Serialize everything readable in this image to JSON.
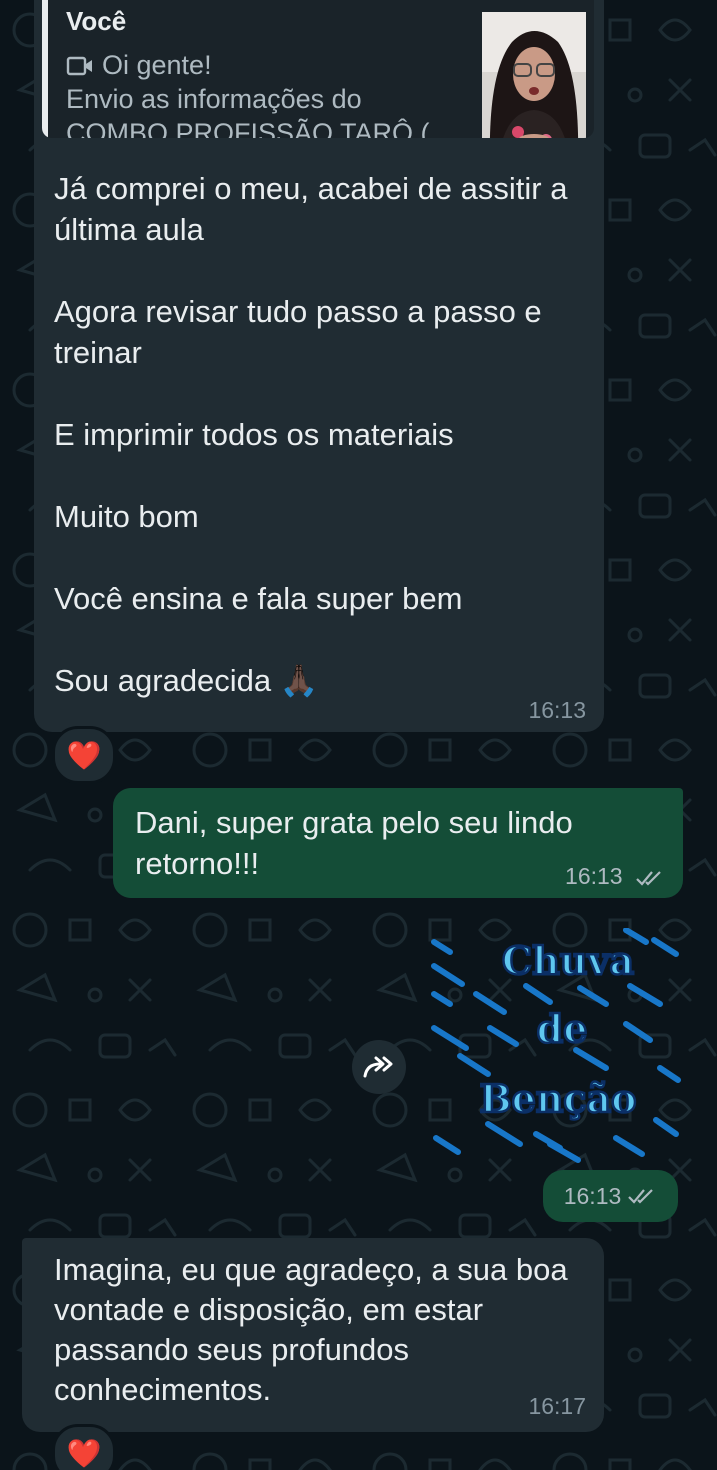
{
  "colors": {
    "background": "#0b141a",
    "incoming_bubble": "#202c33",
    "outgoing_bubble": "#144d37",
    "timestamp": "#8696a0",
    "read_ticks": "#aebac1"
  },
  "messages": [
    {
      "direction": "incoming",
      "quote": {
        "author": "Você",
        "line1_icon": "video-icon",
        "line1": "Oi gente!",
        "line2": "Envio as informações do",
        "line3": "COMBO PROFISSÃO TARÔ (..."
      },
      "paragraphs": [
        "Já comprei o meu, acabei de assitir a última aula",
        "Agora revisar tudo passo a passo e treinar",
        "E imprimir todos os materiais",
        "Muito bom",
        "Você ensina e fala super bem",
        "Sou agradecida 🙏🏿"
      ],
      "time": "16:13",
      "reaction": "❤️"
    },
    {
      "direction": "outgoing",
      "text": "Dani, super grata pelo seu lindo retorno!!!",
      "time": "16:13",
      "status": "read"
    },
    {
      "direction": "outgoing",
      "type": "sticker",
      "sticker_text": [
        "Chuva",
        "de",
        "Benção"
      ],
      "time": "16:13",
      "status": "read"
    },
    {
      "direction": "incoming",
      "text": "Imagina, eu que agradeço, a sua boa vontade e disposição, em estar passando seus profundos conhecimentos.",
      "time": "16:17",
      "reaction": "❤️"
    }
  ]
}
